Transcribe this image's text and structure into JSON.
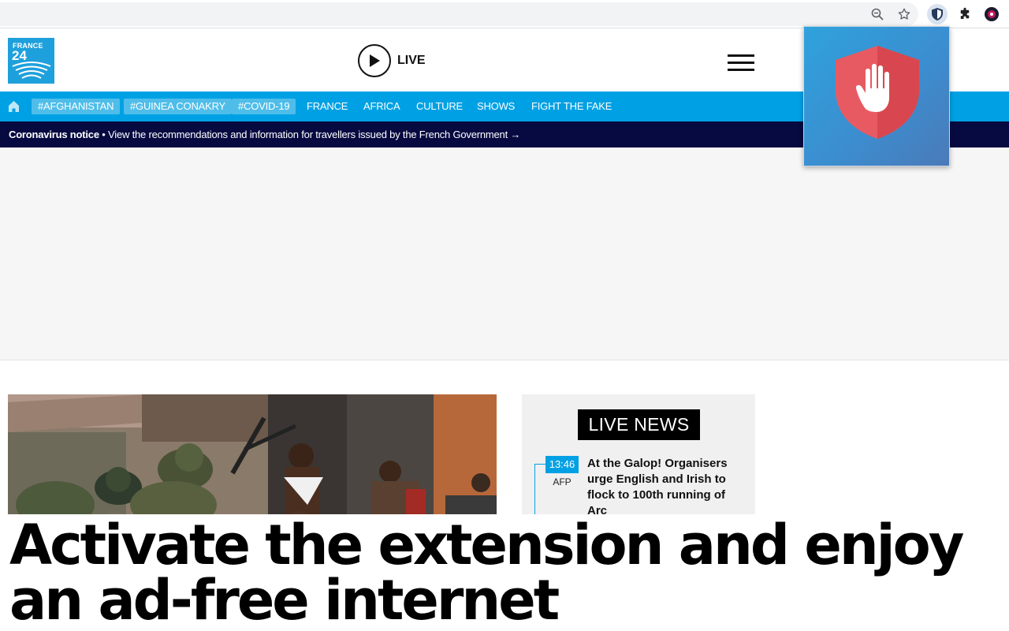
{
  "browser": {
    "toolbar_icons": [
      "zoom-out-icon",
      "star-icon",
      "shield-extension-icon",
      "puzzle-extensions-icon",
      "profile-icon"
    ],
    "omnibox_color": "#f1f3f4"
  },
  "site": {
    "logo_top": "FRANCE",
    "logo_bottom": "24",
    "live_label": "LIVE",
    "nav": {
      "tags": [
        "#AFGHANISTAN",
        "#GUINEA CONAKRY",
        "#COVID-19"
      ],
      "links": [
        "FRANCE",
        "AFRICA",
        "CULTURE",
        "SHOWS",
        "FIGHT THE FAKE"
      ]
    },
    "notice": {
      "bold": "Coronavirus notice",
      "text": " • View the recommendations and information for travellers issued by the French Government →"
    },
    "live_news": {
      "title": "LIVE NEWS",
      "items": [
        {
          "time": "13:46",
          "source": "AFP",
          "headline": "At the Galop! Organisers urge English and Irish to flock to 100th running of Arc"
        }
      ]
    }
  },
  "overlay": {
    "caption": "Activate the extension and enjoy an ad-free internet"
  },
  "colors": {
    "brand_blue": "#00a1e4",
    "notice_navy": "#060a41",
    "shield_red": "#e85a62"
  }
}
